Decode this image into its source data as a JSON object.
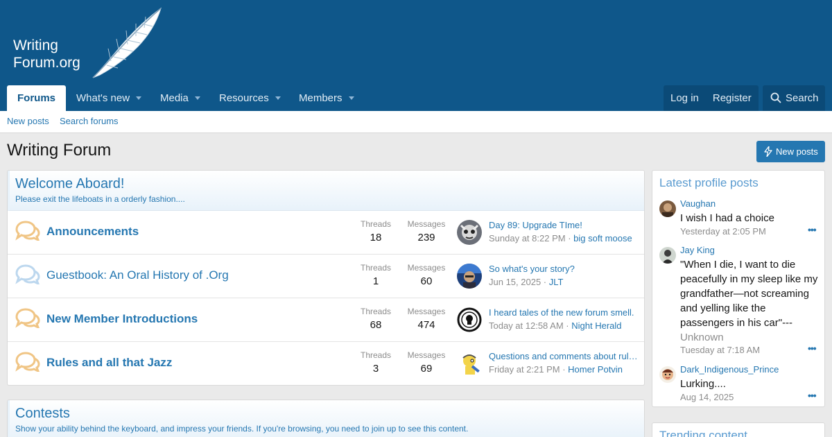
{
  "logo": {
    "line1": "Writing",
    "line2": "Forum.org"
  },
  "nav": {
    "tabs": [
      {
        "label": "Forums"
      },
      {
        "label": "What's new"
      },
      {
        "label": "Media"
      },
      {
        "label": "Resources"
      },
      {
        "label": "Members"
      }
    ],
    "login": "Log in",
    "register": "Register",
    "search": "Search"
  },
  "subnav": {
    "new_posts": "New posts",
    "search_forums": "Search forums"
  },
  "page": {
    "title": "Writing Forum",
    "new_posts_button": "New posts"
  },
  "category": {
    "title": "Welcome Aboard!",
    "description": "Please exit the lifeboats in a orderly fashion....",
    "stat_threads_label": "Threads",
    "stat_messages_label": "Messages",
    "nodes": [
      {
        "title": "Announcements",
        "threads": "18",
        "messages": "239",
        "last_title": "Day 89: Upgrade TIme!",
        "last_time": "Sunday at 8:22 PM",
        "last_user": "big soft moose",
        "unread": true
      },
      {
        "title": "Guestbook: An Oral History of .Org",
        "threads": "1",
        "messages": "60",
        "last_title": "So what's your story?",
        "last_time": "Jun 15, 2025",
        "last_user": "JLT",
        "unread": false
      },
      {
        "title": "New Member Introductions",
        "threads": "68",
        "messages": "474",
        "last_title": "I heard tales of the new forum smell.",
        "last_time": "Today at 12:58 AM",
        "last_user": "Night Herald",
        "unread": true
      },
      {
        "title": "Rules and all that Jazz",
        "threads": "3",
        "messages": "69",
        "last_title": "Questions and comments about rules...",
        "last_time": "Friday at 2:21 PM",
        "last_user": "Homer Potvin",
        "unread": true
      }
    ]
  },
  "category2": {
    "title": "Contests",
    "description": "Show your ability behind the keyboard, and impress your friends. If you're browsing, you need to join up to see this content."
  },
  "sidebar": {
    "latest_title": "Latest profile posts",
    "posts": [
      {
        "user": "Vaughan",
        "message": "I wish I had a choice",
        "time": "Yesterday at 2:05 PM"
      },
      {
        "user": "Jay King",
        "message": "\"When I die, I want to die peacefully in my sleep like my grandfather—not screaming and yelling like the passengers in his car\"---",
        "message_tail": "Unknown",
        "time": "Tuesday at 7:18 AM"
      },
      {
        "user": "Dark_Indigenous_Prince",
        "message": "Lurking....",
        "time": "Aug 14, 2025"
      }
    ],
    "more_label": "•••",
    "trending_title": "Trending content"
  },
  "colors": {
    "header": "#0f578a",
    "link": "#2577b1",
    "accent_icon": "#f0c585",
    "read_icon": "#bcd7ee"
  }
}
